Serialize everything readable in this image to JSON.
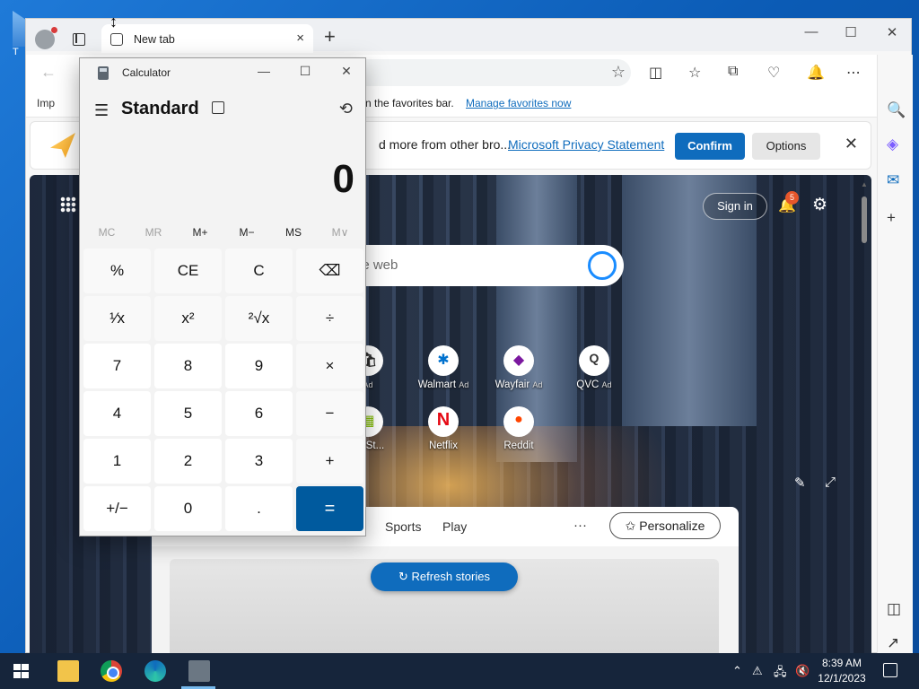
{
  "desktop": {
    "icon_label": "T"
  },
  "browser": {
    "tab_title": "New tab",
    "tab_close": "×",
    "new_tab": "+",
    "win_min": "—",
    "win_max": "☐",
    "win_close": "✕",
    "back": "←",
    "star": "☆",
    "favbar": {
      "import_label": "Imp",
      "message": "n the favorites bar.",
      "manage_link": "Manage favorites now"
    },
    "notification": {
      "message": "d more from other bro...",
      "privacy_link": "Microsoft Privacy Statement",
      "confirm": "Confirm",
      "options": "Options",
      "close": "✕"
    },
    "ntp": {
      "sign_in": "Sign in",
      "notification_count": "5",
      "search_placeholder": "he web",
      "tiles": [
        {
          "label": "Ad",
          "ad": ""
        },
        {
          "label": "Walmart",
          "ad": "Ad"
        },
        {
          "label": "Wayfair",
          "ad": "Ad"
        },
        {
          "label": "QVC",
          "ad": "Ad"
        },
        {
          "label": "oft St...",
          "ad": ""
        },
        {
          "label": "Netflix",
          "ad": ""
        },
        {
          "label": "Reddit",
          "ad": ""
        }
      ],
      "feed_nav": [
        "Sports",
        "Play"
      ],
      "more": "···",
      "personalize": "Personalize",
      "refresh_stories": "Refresh stories"
    }
  },
  "calculator": {
    "window_title": "Calculator",
    "mode": "Standard",
    "display": "0",
    "memory": [
      "MC",
      "MR",
      "M+",
      "M−",
      "MS",
      "M∨"
    ],
    "keys": [
      [
        "%",
        "CE",
        "C",
        "⌫"
      ],
      [
        "¹⁄x",
        "x²",
        "²√x",
        "÷"
      ],
      [
        "7",
        "8",
        "9",
        "×"
      ],
      [
        "4",
        "5",
        "6",
        "−"
      ],
      [
        "1",
        "2",
        "3",
        "+"
      ],
      [
        "+/−",
        "0",
        ".",
        "="
      ]
    ]
  },
  "taskbar": {
    "time": "8:39 AM",
    "date": "12/1/2023"
  },
  "colors": {
    "accent": "#0f6cbd",
    "calc_equals": "#005a9e",
    "taskbar": "#16253b"
  }
}
